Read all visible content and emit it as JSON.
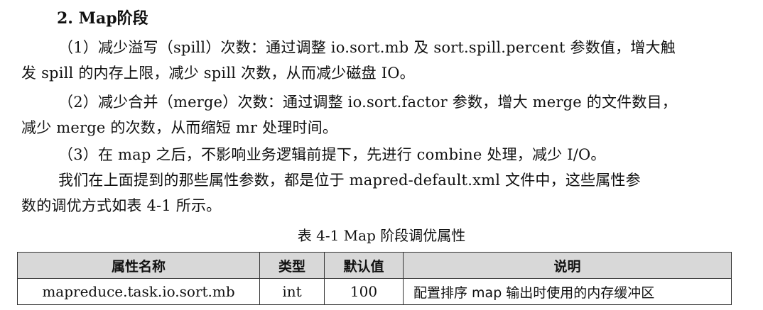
{
  "section": {
    "heading": "2. Map阶段"
  },
  "paragraphs": [
    {
      "lines": [
        "（1）减少溢写（spill）次数：通过调整 io.sort.mb 及 sort.spill.percent 参数值，增大触",
        "发 spill 的内存上限，减少 spill 次数，从而减少磁盘 IO。"
      ]
    },
    {
      "lines": [
        "（2）减少合并（merge）次数：通过调整 io.sort.factor 参数，增大 merge 的文件数目，",
        "减少 merge 的次数，从而缩短 mr 处理时间。"
      ]
    },
    {
      "lines": [
        "（3）在 map 之后，不影响业务逻辑前提下，先进行 combine 处理，减少 I/O。"
      ]
    },
    {
      "lines": [
        "我们在上面提到的那些属性参数，都是位于 mapred-default.xml 文件中，这些属性参",
        "数的调优方式如表 4-1 所示。"
      ]
    }
  ],
  "table": {
    "caption": "表 4-1  Map 阶段调优属性",
    "headers": [
      "属性名称",
      "类型",
      "默认值",
      "说明"
    ],
    "rows": [
      [
        "mapreduce.task.io.sort.mb",
        "int",
        "100",
        "配置排序 map 输出时使用的内存缓冲区"
      ]
    ]
  }
}
